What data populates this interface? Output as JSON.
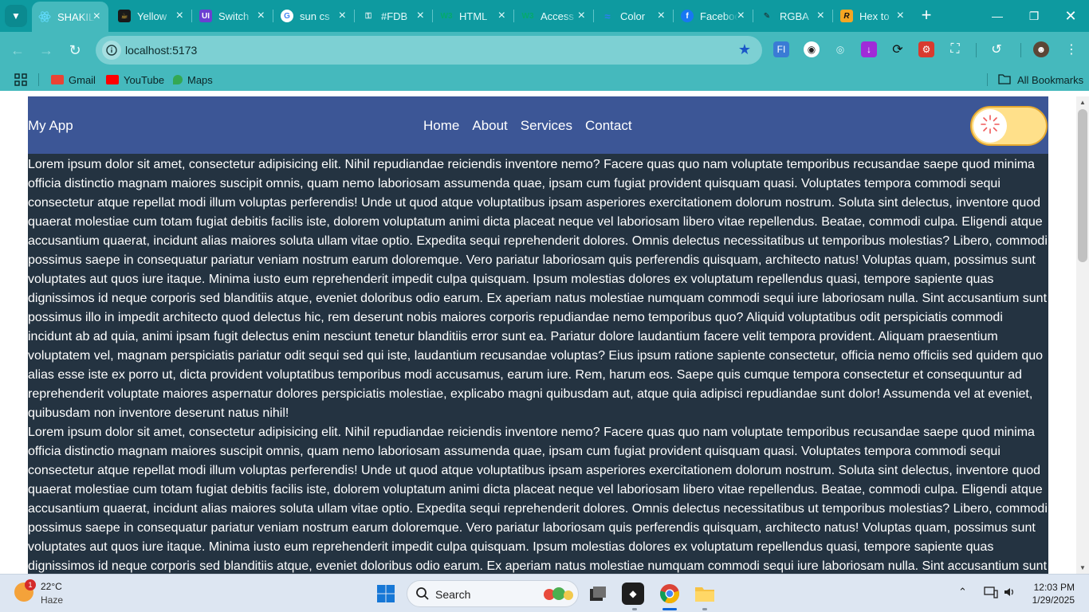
{
  "browser": {
    "tabs": [
      {
        "title": "SHAKIL",
        "icon": "react-icon",
        "color": "#61dafb",
        "active": true
      },
      {
        "title": "Yellow",
        "icon": "cup-icon",
        "color": "#f6c33a"
      },
      {
        "title": "Switch",
        "icon": "ui-logo-icon",
        "color": "#6b3fd1"
      },
      {
        "title": "sun cs",
        "icon": "google-icon",
        "color": "#ffffff"
      },
      {
        "title": "#FDB",
        "icon": "lock-icon",
        "color": "#cfe9ea"
      },
      {
        "title": "HTML",
        "icon": "w3-icon",
        "color": "#04aa6d"
      },
      {
        "title": "Access",
        "icon": "w3-icon",
        "color": "#04aa6d"
      },
      {
        "title": "Color",
        "icon": "wave-icon",
        "color": "#2d7df6"
      },
      {
        "title": "Facebook",
        "icon": "facebook-icon",
        "color": "#1877f2"
      },
      {
        "title": "RGBA",
        "icon": "pen-icon",
        "color": "#222222"
      },
      {
        "title": "Hex to",
        "icon": "r-logo-icon",
        "color": "#e8562a"
      }
    ],
    "url": "localhost:5173",
    "bookmarks": [
      {
        "label": "Gmail",
        "icon": "gmail-icon",
        "color": "#ea4335"
      },
      {
        "label": "YouTube",
        "icon": "youtube-icon",
        "color": "#ff0000"
      },
      {
        "label": "Maps",
        "icon": "maps-icon",
        "color": "#34a853"
      }
    ],
    "all_bookmarks": "All Bookmarks"
  },
  "app": {
    "brand": "My App",
    "nav": [
      "Home",
      "About",
      "Services",
      "Contact"
    ],
    "toggle": {
      "state": "light",
      "icon": "sun-icon"
    },
    "paragraphs": [
      "Lorem ipsum dolor sit amet, consectetur adipisicing elit. Nihil repudiandae reiciendis inventore nemo? Facere quas quo nam voluptate temporibus recusandae saepe quod minima officia distinctio magnam maiores suscipit omnis, quam nemo laboriosam assumenda quae, ipsam cum fugiat provident quisquam quasi. Voluptates tempora commodi sequi consectetur atque repellat modi illum voluptas perferendis! Unde ut quod atque voluptatibus ipsam asperiores exercitationem dolorum nostrum. Soluta sint delectus, inventore quod quaerat molestiae cum totam fugiat debitis facilis iste, dolorem voluptatum animi dicta placeat neque vel laboriosam libero vitae repellendus. Beatae, commodi culpa. Eligendi atque accusantium quaerat, incidunt alias maiores soluta ullam vitae optio. Expedita sequi reprehenderit dolores. Omnis delectus necessitatibus ut temporibus molestias? Libero, commodi possimus saepe in consequatur pariatur veniam nostrum earum doloremque. Vero pariatur laboriosam quis perferendis quisquam, architecto natus! Voluptas quam, possimus sunt voluptates aut quos iure itaque. Minima iusto eum reprehenderit impedit culpa quisquam. Ipsum molestias dolores ex voluptatum repellendus quasi, tempore sapiente quas dignissimos id neque corporis sed blanditiis atque, eveniet doloribus odio earum. Ex aperiam natus molestiae numquam commodi sequi iure laboriosam nulla. Sint accusantium sunt possimus illo in impedit architecto quod delectus hic, rem deserunt nobis maiores corporis repudiandae nemo temporibus quo? Aliquid voluptatibus odit perspiciatis commodi incidunt ab ad quia, animi ipsam fugit delectus enim nesciunt tenetur blanditiis error sunt ea. Pariatur dolore laudantium facere velit tempora provident. Aliquam praesentium voluptatem vel, magnam perspiciatis pariatur odit sequi sed qui iste, laudantium recusandae voluptas? Eius ipsum ratione sapiente consectetur, officia nemo officiis sed quidem quo alias esse iste ex porro ut, dicta provident voluptatibus temporibus modi accusamus, earum iure. Rem, harum eos. Saepe quis cumque tempora consectetur et consequuntur ad reprehenderit voluptate maiores aspernatur dolores perspiciatis molestiae, explicabo magni quibusdam aut, atque quia adipisci repudiandae sunt dolor! Assumenda vel at eveniet, quibusdam non inventore deserunt natus nihil!",
      "Lorem ipsum dolor sit amet, consectetur adipisicing elit. Nihil repudiandae reiciendis inventore nemo? Facere quas quo nam voluptate temporibus recusandae saepe quod minima officia distinctio magnam maiores suscipit omnis, quam nemo laboriosam assumenda quae, ipsam cum fugiat provident quisquam quasi. Voluptates tempora commodi sequi consectetur atque repellat modi illum voluptas perferendis! Unde ut quod atque voluptatibus ipsam asperiores exercitationem dolorum nostrum. Soluta sint delectus, inventore quod quaerat molestiae cum totam fugiat debitis facilis iste, dolorem voluptatum animi dicta placeat neque vel laboriosam libero vitae repellendus. Beatae, commodi culpa. Eligendi atque accusantium quaerat, incidunt alias maiores soluta ullam vitae optio. Expedita sequi reprehenderit dolores. Omnis delectus necessitatibus ut temporibus molestias? Libero, commodi possimus saepe in consequatur pariatur veniam nostrum earum doloremque. Vero pariatur laboriosam quis perferendis quisquam, architecto natus! Voluptas quam, possimus sunt voluptates aut quos iure itaque. Minima iusto eum reprehenderit impedit culpa quisquam. Ipsum molestias dolores ex voluptatum repellendus quasi, tempore sapiente quas dignissimos id neque corporis sed blanditiis atque, eveniet doloribus odio earum. Ex aperiam natus molestiae numquam commodi sequi iure laboriosam nulla. Sint accusantium sunt"
    ],
    "colors": {
      "header": "#3c5696",
      "body": "#243341",
      "toggle": "#ffe08a"
    }
  },
  "taskbar": {
    "weather": {
      "temp": "22°C",
      "condition": "Haze",
      "badge": "1"
    },
    "search_label": "Search",
    "time": "12:03 PM",
    "date": "1/29/2025"
  }
}
